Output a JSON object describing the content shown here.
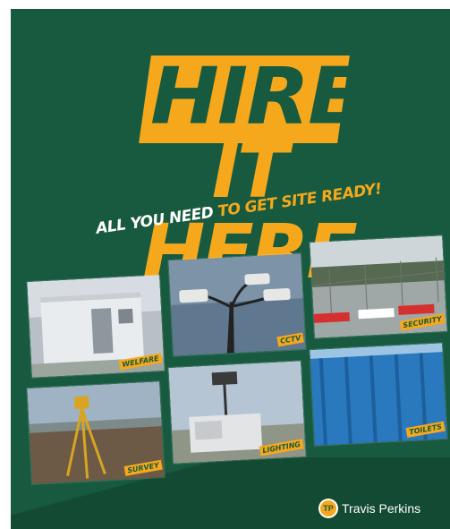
{
  "headline": {
    "line1": "HIRE",
    "line2": "IT HERE"
  },
  "tagline": {
    "white": "ALL YOU NEED",
    "yellow": "TO GET SITE READY!"
  },
  "cards": [
    "WELFARE",
    "CCTV",
    "SECURITY",
    "SURVEY",
    "LIGHTING",
    "TOILETS"
  ],
  "brand": {
    "name": "Travis Perkins",
    "badge": "TP"
  },
  "colors": {
    "green": "#175a3f",
    "yellow": "#f5a81c"
  }
}
